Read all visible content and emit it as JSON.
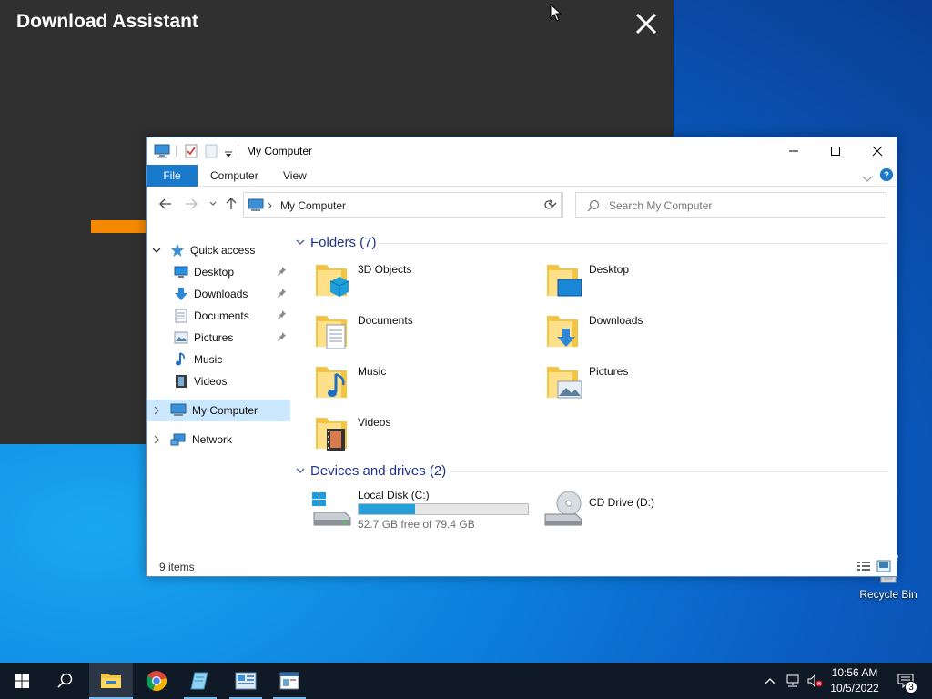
{
  "download_assistant": {
    "title": "Download Assistant",
    "progress_fraction": 0.1
  },
  "desktop": {
    "recycle_bin_label": "Recycle Bin"
  },
  "explorer": {
    "title": "My Computer",
    "tabs": {
      "file": "File",
      "computer": "Computer",
      "view": "View"
    },
    "address": {
      "path": "My Computer",
      "search_placeholder": "Search My Computer"
    },
    "nav": {
      "quick_access": "Quick access",
      "quick_items": [
        {
          "label": "Desktop",
          "icon": "desktop-icon",
          "pinned": true
        },
        {
          "label": "Downloads",
          "icon": "downloads-icon",
          "pinned": true
        },
        {
          "label": "Documents",
          "icon": "documents-icon",
          "pinned": true
        },
        {
          "label": "Pictures",
          "icon": "pictures-icon",
          "pinned": true
        },
        {
          "label": "Music",
          "icon": "music-icon",
          "pinned": false
        },
        {
          "label": "Videos",
          "icon": "videos-icon",
          "pinned": false
        }
      ],
      "my_computer": "My Computer",
      "network": "Network"
    },
    "folders_header": "Folders (7)",
    "folders": [
      {
        "label": "3D Objects",
        "icon": "3d-objects-folder-icon"
      },
      {
        "label": "Desktop",
        "icon": "desktop-folder-icon"
      },
      {
        "label": "Documents",
        "icon": "documents-folder-icon"
      },
      {
        "label": "Downloads",
        "icon": "downloads-folder-icon"
      },
      {
        "label": "Music",
        "icon": "music-folder-icon"
      },
      {
        "label": "Pictures",
        "icon": "pictures-folder-icon"
      },
      {
        "label": "Videos",
        "icon": "videos-folder-icon"
      }
    ],
    "drives_header": "Devices and drives (2)",
    "drives": [
      {
        "label": "Local Disk (C:)",
        "free_text": "52.7 GB free of 79.4 GB",
        "used_fraction": 0.336
      },
      {
        "label": "CD Drive (D:)"
      }
    ],
    "status": "9 items"
  },
  "taskbar": {
    "clock_time": "10:56 AM",
    "clock_date": "10/5/2022",
    "notification_count": "3"
  },
  "colors": {
    "accent": "#1979ca",
    "selection": "#cce8ff",
    "header_text": "#1e3287",
    "drive_fill": "#26a0da",
    "download_progress": "#f58a00",
    "taskbar": "#101a26"
  }
}
